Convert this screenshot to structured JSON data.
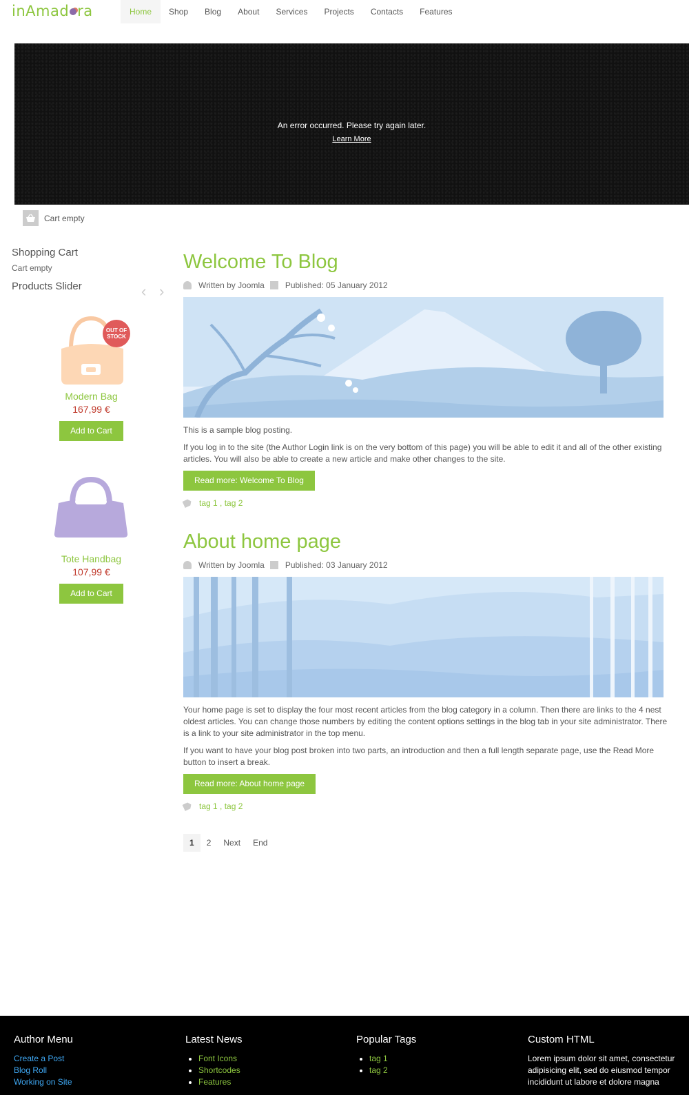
{
  "brand": {
    "logo_text_a": "inAmad",
    "logo_text_b": "ra"
  },
  "nav": {
    "items": [
      {
        "label": "Home"
      },
      {
        "label": "Shop"
      },
      {
        "label": "Blog"
      },
      {
        "label": "About"
      },
      {
        "label": "Services"
      },
      {
        "label": "Projects"
      },
      {
        "label": "Contacts"
      },
      {
        "label": "Features"
      }
    ]
  },
  "banner": {
    "message": "An error occurred. Please try again later.",
    "link": "Learn More"
  },
  "cartbar": {
    "text": "Cart empty"
  },
  "sidebar": {
    "cart_title": "Shopping Cart",
    "cart_status": "Cart empty",
    "slider_title": "Products Slider",
    "products": [
      {
        "name": "Modern Bag",
        "price": "167,99 €",
        "badge": "OUT OF STOCK",
        "button": "Add to Cart"
      },
      {
        "name": "Tote Handbag",
        "price": "107,99 €",
        "button": "Add to Cart"
      }
    ]
  },
  "articles": [
    {
      "title": "Welcome To Blog",
      "author": "Written by Joomla",
      "published": "Published: 05 January 2012",
      "paragraphs": [
        "This is a sample blog posting.",
        "If you log in to the site (the Author Login link is on the very bottom of this page) you will be able to edit it and all of the other existing articles. You will also be able to create a new article and make other changes to the site."
      ],
      "read_more": "Read more: Welcome To Blog",
      "tags": "tag 1 , tag 2"
    },
    {
      "title": "About home page",
      "author": "Written by Joomla",
      "published": "Published: 03 January 2012",
      "paragraphs": [
        "Your home page is set to display the four most recent articles from the blog category in a column. Then there are links to the 4 nest oldest articles. You can change those numbers by editing the content options settings in the blog tab in your site administrator. There is a link to your site administrator in the top menu.",
        "If you want to have your blog post broken into two parts, an introduction and then a full length separate page, use the Read More button to insert a break."
      ],
      "read_more": "Read more: About home page",
      "tags": "tag 1 , tag 2"
    }
  ],
  "pagination": {
    "items": [
      "1",
      "2",
      "Next",
      "End"
    ]
  },
  "footer": {
    "author_menu": {
      "title": "Author Menu",
      "links": [
        "Create a Post",
        "Blog Roll",
        "Working on Site"
      ]
    },
    "latest_news": {
      "title": "Latest News",
      "links": [
        "Font Icons",
        "Shortcodes",
        "Features"
      ]
    },
    "popular_tags": {
      "title": "Popular Tags",
      "links": [
        "tag 1",
        "tag 2"
      ]
    },
    "custom_html": {
      "title": "Custom HTML",
      "text": "Lorem ipsum dolor sit amet, consectetur adipisicing elit, sed do eiusmod tempor incididunt ut labore et dolore magna"
    }
  },
  "colors": {
    "accent": "#8dc63f",
    "price": "#c0392b",
    "link_blue": "#3fa9f5",
    "footer_bg": "#000000"
  }
}
